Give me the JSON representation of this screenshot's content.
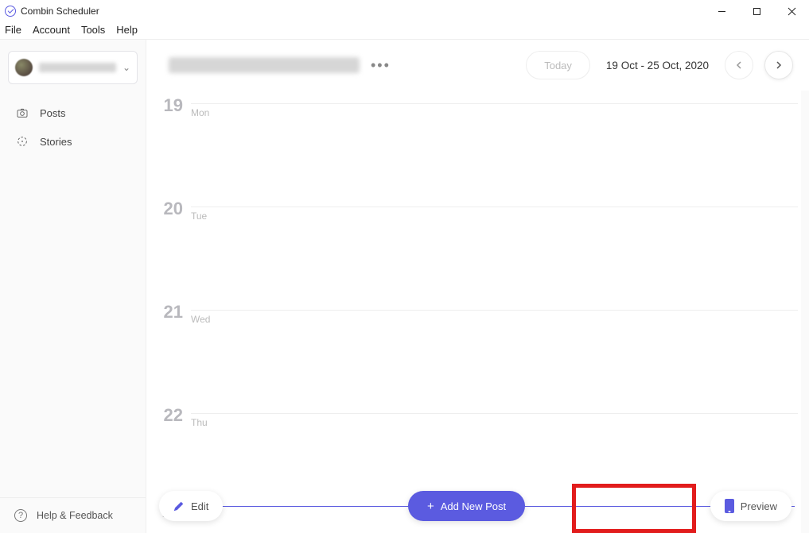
{
  "app": {
    "title": "Combin Scheduler"
  },
  "menu": {
    "file": "File",
    "account": "Account",
    "tools": "Tools",
    "help": "Help"
  },
  "sidebar": {
    "nav": {
      "posts": "Posts",
      "stories": "Stories"
    },
    "footer": {
      "help": "Help & Feedback"
    }
  },
  "header": {
    "today": "Today",
    "date_range": "19 Oct - 25 Oct, 2020"
  },
  "days": [
    {
      "num": "19",
      "dow": "Mon"
    },
    {
      "num": "20",
      "dow": "Tue"
    },
    {
      "num": "21",
      "dow": "Wed"
    },
    {
      "num": "22",
      "dow": "Thu"
    }
  ],
  "actions": {
    "edit": "Edit",
    "add": "Add New Post",
    "preview": "Preview"
  }
}
